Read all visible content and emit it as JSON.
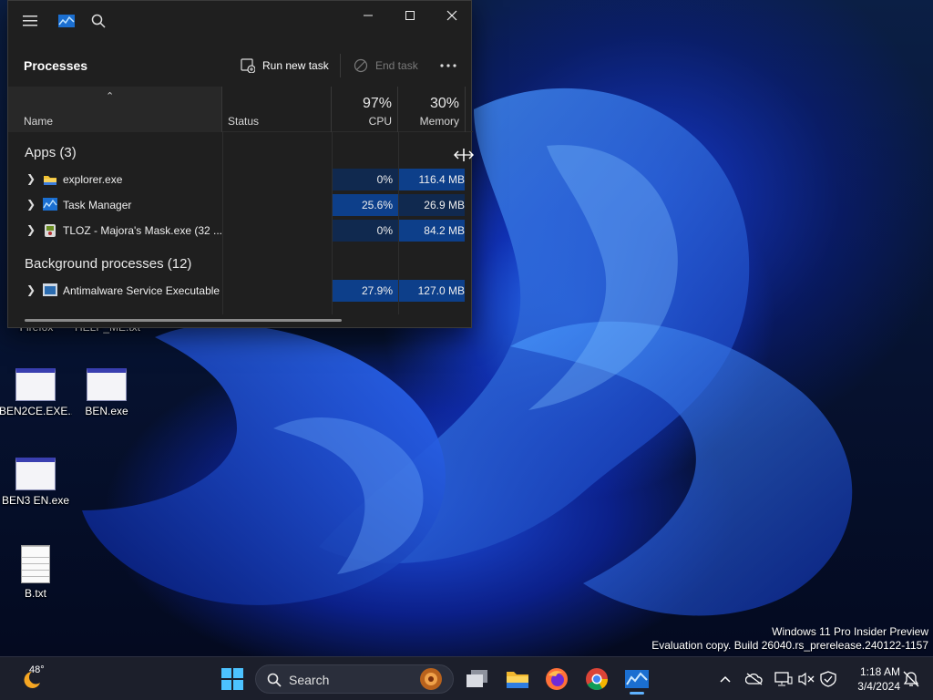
{
  "desktop": {
    "icons": [
      {
        "label": "Firefox",
        "kind": "app"
      },
      {
        "label": "HELP_ME.txt",
        "kind": "text"
      },
      {
        "label": "BEN2CE.EXE...",
        "kind": "window"
      },
      {
        "label": "BEN.exe",
        "kind": "window"
      },
      {
        "label": "BEN3 EN.exe",
        "kind": "window"
      },
      {
        "label": "B.txt",
        "kind": "text"
      }
    ],
    "watermark": {
      "line1": "Windows 11 Pro Insider Preview",
      "line2": "Evaluation copy. Build 26040.rs_prerelease.240122-1157"
    }
  },
  "taskmgr": {
    "title": "Processes",
    "run_new_task": "Run new task",
    "end_task": "End task",
    "columns": {
      "name": "Name",
      "status": "Status",
      "cpu_pct": "97%",
      "cpu_label": "CPU",
      "mem_pct": "30%",
      "mem_label": "Memory"
    },
    "groups": {
      "apps": "Apps (3)",
      "background": "Background processes (12)"
    },
    "apps": [
      {
        "name": "explorer.exe",
        "cpu": "0%",
        "memory": "116.4 MB",
        "icon": "folder-icon"
      },
      {
        "name": "Task Manager",
        "cpu": "25.6%",
        "memory": "26.9 MB",
        "icon": "taskmgr-icon"
      },
      {
        "name": "TLOZ - Majora's Mask.exe (32 ...",
        "cpu": "0%",
        "memory": "84.2 MB",
        "icon": "game-icon"
      }
    ],
    "background": [
      {
        "name": "Antimalware Service Executable",
        "cpu": "27.9%",
        "memory": "127.0 MB",
        "icon": "defender-icon"
      }
    ]
  },
  "taskbar": {
    "weather_temp": "48°",
    "search_label": "Search",
    "time": "1:18 AM",
    "date": "3/4/2024",
    "accent": "#5fb2ff"
  }
}
